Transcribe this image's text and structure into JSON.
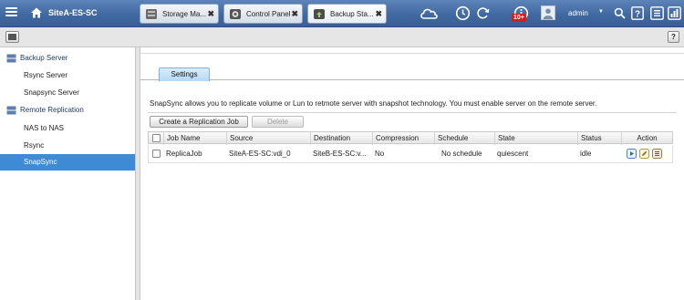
{
  "topbar": {
    "app_title": "SiteA-ES-SC",
    "tabs": [
      {
        "label": "Storage Ma...",
        "close": "✖",
        "icon": "storage-icon"
      },
      {
        "label": "Control Panel",
        "close": "✖",
        "icon": "control-panel-icon"
      },
      {
        "label": "Backup Sta...",
        "close": "✖",
        "icon": "backup-station-icon"
      }
    ],
    "notification_badge": "10+",
    "user": "admin",
    "user_caret": "▼",
    "colors": {
      "bar": "#3f67a0",
      "badge": "#d41c1c",
      "selected": "#3f8ad5"
    }
  },
  "subbar": {
    "help": "?"
  },
  "sidebar": {
    "groups": [
      {
        "label": "Backup Server",
        "icon": "server-icon",
        "items": [
          "Rsync Server",
          "Snapsync Server"
        ]
      },
      {
        "label": "Remote Replication",
        "icon": "replication-icon",
        "items": [
          "NAS to NAS",
          "Rsync",
          "SnapSync"
        ]
      }
    ],
    "selected": "SnapSync"
  },
  "main": {
    "tab": "Settings",
    "description": "SnapSync allows you to replicate volume or Lun to retmote server with snapshot technology. You must enable server on the remote server.",
    "buttons": {
      "create": "Create a Replication Job",
      "delete": "Delete"
    },
    "table": {
      "columns": [
        "Job Name",
        "Source",
        "Destination",
        "Compression",
        "Schedule",
        "State",
        "Status",
        "Action"
      ],
      "rows": [
        {
          "job_name": "ReplicaJob",
          "source": "SiteA-ES-SC:vdi_0",
          "destination": "SiteB-ES-SC:v...",
          "compression": "No",
          "schedule": "No schedule",
          "state": "quiescent",
          "status": "idle"
        }
      ]
    }
  }
}
